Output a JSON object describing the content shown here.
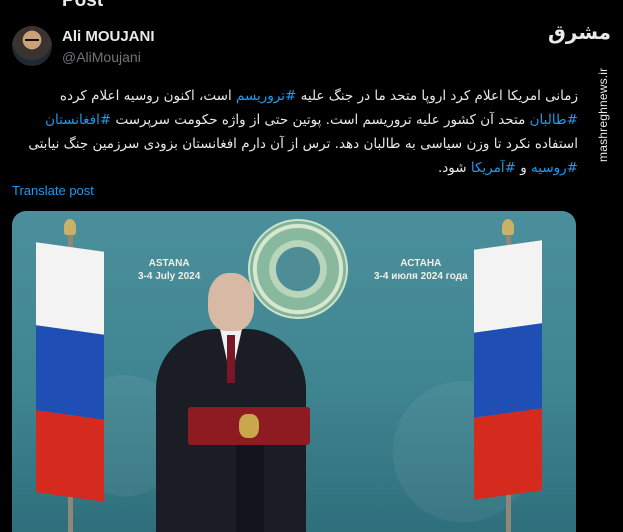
{
  "header": {
    "title": "Post"
  },
  "author": {
    "name": "Ali MOUJANI",
    "handle": "@AliMoujani"
  },
  "watermark": {
    "logo_text": "مشرق",
    "site": "mashreghnews.ir"
  },
  "tweet": {
    "line1": "زمانی امریکا اعلام کرد اروپا متحد ما در جنگ علیه ",
    "hashtag1": "#تروریسم",
    "line1b": " است، اکنون روسیه اعلام کرده",
    "hashtag2": "#طالبان",
    "line2": " متحد آن کشور علیه تروریسم است. پوتین حتی از واژه حکومت سرپرست ",
    "hashtag3": "#افغانستان",
    "line3": "استفاده نکرد تا وزن سیاسی به طالبان دهد. ترس از آن دارم افغانستان بزودی سرزمین جنگ نیابتی",
    "hashtag4": "#روسیه",
    "line4a": " و ",
    "hashtag5": "#آمریکا",
    "line4b": " شود."
  },
  "translate_label": "Translate post",
  "media": {
    "event_left_line1": "ASTANA",
    "event_left_line2": "3-4 July 2024",
    "event_right_line1": "АСТАНА",
    "event_right_line2": "3-4 июля 2024 года"
  },
  "colors": {
    "link": "#1d9bf0",
    "background": "#000000",
    "text": "#e7e9ea",
    "muted": "#71767b"
  }
}
